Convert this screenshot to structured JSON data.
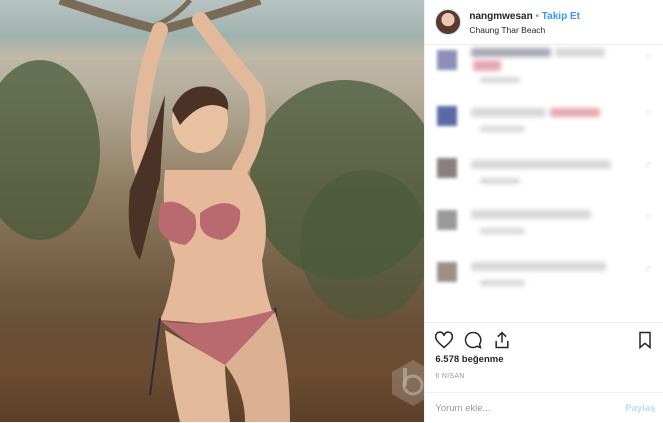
{
  "header": {
    "username": "nangmwesan",
    "separator": "•",
    "follow_label": "Takip Et",
    "location": "Chaung Thar Beach"
  },
  "photo": {
    "description_icon": "beach-photo"
  },
  "comments": [
    {
      "blurred": true
    },
    {
      "blurred": true
    },
    {
      "blurred": true
    },
    {
      "blurred": true
    },
    {
      "blurred": true
    }
  ],
  "actions": {
    "like_icon": "heart-icon",
    "comment_icon": "comment-icon",
    "share_icon": "share-icon",
    "save_icon": "bookmark-icon"
  },
  "likes": "6.578 beğenme",
  "date": "6 NİSAN",
  "comment_box": {
    "placeholder": "Yorum ekle...",
    "post_label": "Paylaş"
  },
  "colors": {
    "link_blue": "#3897f0",
    "text": "#262626",
    "muted": "#999999",
    "disabled_blue": "#b2dffc"
  }
}
